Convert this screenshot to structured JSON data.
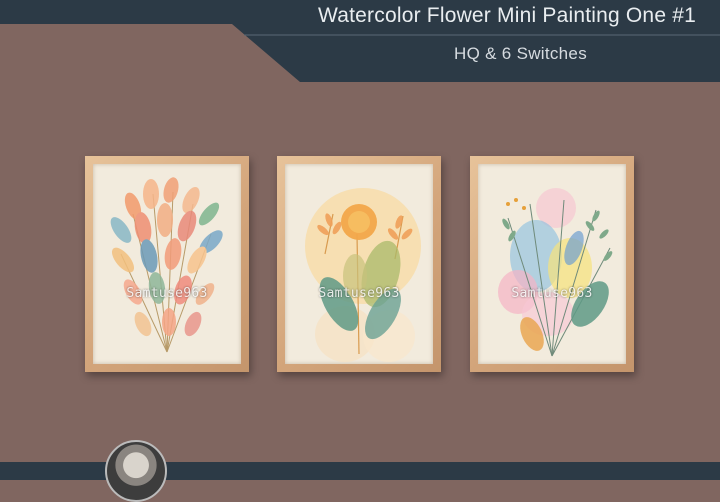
{
  "banner": {
    "title": "Watercolor Flower Mini Painting One #1",
    "subtitle": "HQ & 6 Switches"
  },
  "paintings": [
    {
      "watermark": "Samtuse963"
    },
    {
      "watermark": "Samtuse963"
    },
    {
      "watermark": "Samtuse963"
    }
  ],
  "colors": {
    "background": "#806660",
    "banner": "#2c3a46",
    "frame": "#d3a57b",
    "canvas": "#f2ebdd"
  }
}
